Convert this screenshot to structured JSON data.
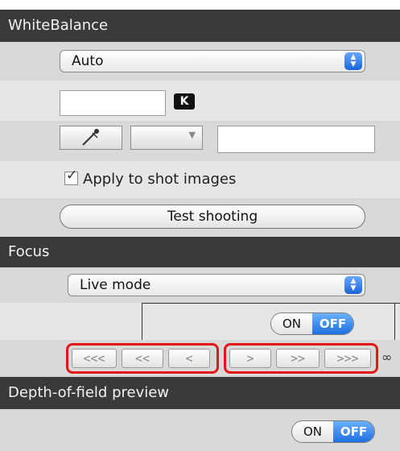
{
  "white_balance": {
    "header": "WhiteBalance",
    "preset_value": "Auto",
    "kelvin_value": "",
    "k_label": "K",
    "eyedropper_label": "",
    "dropdown_value": "",
    "text_field_value": "",
    "apply_label": "Apply to shot images",
    "apply_checked": true,
    "test_button": "Test shooting"
  },
  "focus": {
    "header": "Focus",
    "mode_value": "Live mode",
    "toggle_on": "ON",
    "toggle_off": "OFF",
    "toggle_selected": "OFF",
    "nav_left": [
      "<<<",
      "<<",
      "<"
    ],
    "nav_right": [
      ">",
      ">>",
      ">>>"
    ],
    "infinity": "∞"
  },
  "dof": {
    "header": "Depth-of-field preview",
    "toggle_on": "ON",
    "toggle_off": "OFF",
    "toggle_selected": "OFF"
  },
  "colors": {
    "header_bg": "#3a3a3a",
    "row_bg": "#d9d9d9",
    "accent_blue": "#1f6fe0",
    "highlight_red": "#e01818"
  },
  "icons": {
    "eyedropper": "eyedropper-icon",
    "select_arrows": "updown-arrows-icon"
  }
}
